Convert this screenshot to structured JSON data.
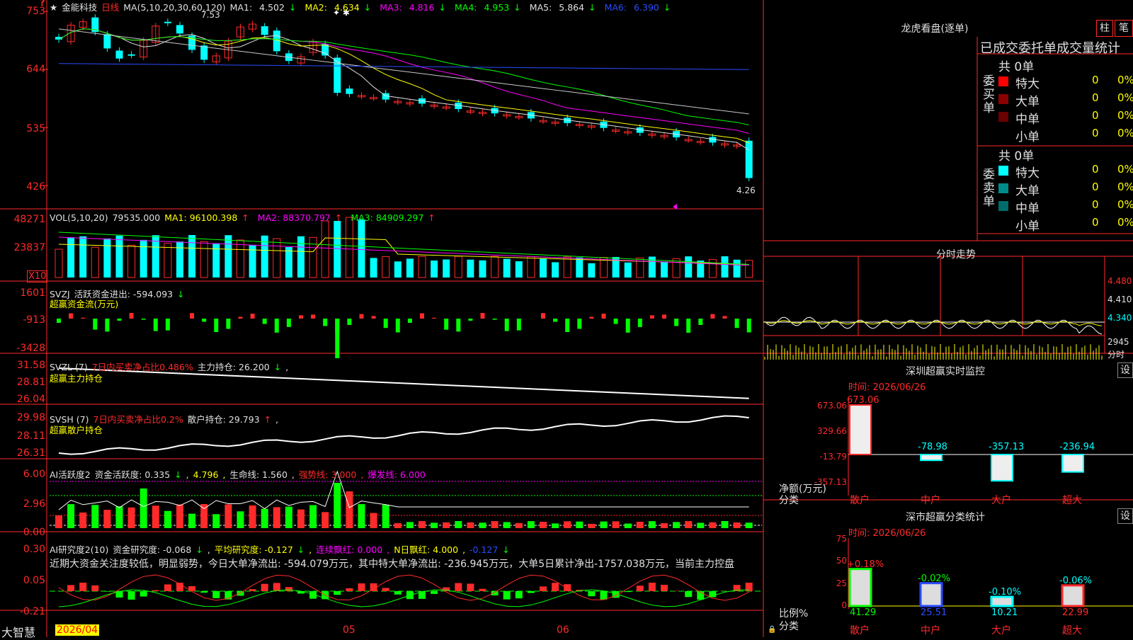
{
  "app": {
    "brand": "大智慧"
  },
  "main": {
    "title": {
      "star": "★",
      "stock_name": "金能科技",
      "period": "日线",
      "ma_caption": "MA(5,10,20,30,60,120)"
    },
    "ma_values": [
      {
        "label": "MA1:",
        "value": "4.502",
        "arrow": "↓",
        "color": "#e0e0e0"
      },
      {
        "label": "MA2:",
        "value": "4.634",
        "arrow": "↓",
        "color": "#ffff00"
      },
      {
        "label": "MA3:",
        "value": "4.816",
        "arrow": "↓",
        "color": "#ff00ff"
      },
      {
        "label": "MA4:",
        "value": "4.953",
        "arrow": "↓",
        "color": "#00ff00"
      },
      {
        "label": "MA5:",
        "value": "5.864",
        "arrow": "↓",
        "color": "#e0e0e0"
      },
      {
        "label": "MA6:",
        "value": "6.390",
        "arrow": "↓",
        "color": "#2a4cff"
      }
    ],
    "price_axis": [
      "753",
      "644",
      "535",
      "426"
    ],
    "high_mark": "7.53",
    "low_mark": "4.26"
  },
  "volume": {
    "caption": "VOL(5,10,20)",
    "value": "79535.000",
    "ma1": "MA1: 96100.398",
    "ma2": "MA2: 88370.797",
    "ma3": "MA3: 84909.297",
    "axis": [
      "48271",
      "23837"
    ],
    "unit": "X10"
  },
  "svzj": {
    "caption": "SVZJ",
    "label": "活跃资金进出: -594.093",
    "arrow": "↓",
    "sub": "超赢资金流(万元)",
    "axis": [
      "1601",
      "-913",
      "-3428"
    ]
  },
  "svzl": {
    "caption": "SVZL (7)",
    "ratio": "7日内买卖净占比0.486%",
    "hold": "主力持仓: 26.200",
    "arrow": "↓",
    "sub": "超赢主力持仓",
    "axis": [
      "31.58",
      "28.81",
      "26.04"
    ]
  },
  "svsh": {
    "caption": "SVSH (7)",
    "ratio": "7日内买卖净占比0.2%",
    "hold": "散户持仓: 29.793",
    "arrow": "↑",
    "sub": "超赢散户持仓",
    "axis": [
      "29.98",
      "28.11",
      "26.31"
    ]
  },
  "ai_active": {
    "caption": "AI活跃度2",
    "label": "资金活跃度: 0.335",
    "a1": "4.796",
    "life": "生命线: 1.560",
    "strong": "强势线: 3.000",
    "burst": "爆发线: 6.000",
    "axis": [
      "6.00",
      "2.96",
      "0.00"
    ]
  },
  "ai_research": {
    "caption": "AI研究度2(10)",
    "label": "资金研究度: -0.068",
    "avg": "平均研究度: -0.127",
    "red": "连续飘红: 0.000",
    "nred": "N日飘红: 4.000",
    "nred2": "-0.127",
    "axis": [
      "0.30",
      "0.05",
      "-0.21"
    ],
    "comment": "近期大资金关注度较低，明显弱势，今日大单净流出: -594.079万元，其中特大单净流出: -236.945万元，大单5日累计净出-1757.038万元，当前主力控盘"
  },
  "dates": [
    "2026/04",
    "05",
    "06"
  ],
  "dragon": {
    "title": "龙虎看盘(逐单)",
    "tab_bar": "柱",
    "tab_stroke": "笔",
    "subtitle": "已成交委托单成交量统计",
    "buy": {
      "side": "委买单",
      "total": "共 0单",
      "rows": [
        {
          "name": "特大",
          "count": "0",
          "pct": "0%",
          "color": "#ff0000"
        },
        {
          "name": "大单",
          "count": "0",
          "pct": "0%",
          "color": "#8b0000"
        },
        {
          "name": "中单",
          "count": "0",
          "pct": "0%",
          "color": "#6b0000"
        },
        {
          "name": "小单",
          "count": "0",
          "pct": "0%",
          "color": ""
        }
      ]
    },
    "sell": {
      "side": "委卖单",
      "total": "共 0单",
      "rows": [
        {
          "name": "特大",
          "count": "0",
          "pct": "0%",
          "color": "#00ffff"
        },
        {
          "name": "大单",
          "count": "0",
          "pct": "0%",
          "color": "#008b8b"
        },
        {
          "name": "中单",
          "count": "0",
          "pct": "0%",
          "color": "#006b6b"
        },
        {
          "name": "小单",
          "count": "0",
          "pct": "0%",
          "color": ""
        }
      ]
    }
  },
  "intraday": {
    "title": "分时走势",
    "axis": [
      "4.480",
      "4.410",
      "4.340"
    ],
    "vol": "2945",
    "vol_unit": "分时"
  },
  "sz_monitor": {
    "title": "深圳超赢实时监控",
    "btn": "设",
    "time": "时间: 2026/06/26",
    "axis": [
      "673.06",
      "329.66",
      "-13.79",
      "-357.13"
    ],
    "ylabel": "净额(万元)",
    "xlabel": "分类",
    "bars": [
      {
        "cat": "散户",
        "val": "673.06",
        "num": 673.06
      },
      {
        "cat": "中户",
        "val": "-78.98",
        "num": -78.98
      },
      {
        "cat": "大户",
        "val": "-357.13",
        "num": -357.13
      },
      {
        "cat": "超大",
        "val": "-236.94",
        "num": -236.94
      }
    ]
  },
  "sz_class": {
    "title": "深市超赢分类统计",
    "btn": "设",
    "time": "时间: 2026/06/26",
    "axis": [
      "75",
      "50",
      "25",
      "0"
    ],
    "ylabel": "比例%",
    "xlabel": "分类",
    "bars": [
      {
        "cat": "散户",
        "top": "+0.18%",
        "val": "41.29",
        "num": 41.29
      },
      {
        "cat": "中户",
        "top": "-0.02%",
        "val": "25.51",
        "num": 25.51
      },
      {
        "cat": "大户",
        "top": "-0.10%",
        "val": "10.21",
        "num": 10.21
      },
      {
        "cat": "超大",
        "top": "-0.06%",
        "val": "22.99",
        "num": 22.99
      }
    ]
  }
}
